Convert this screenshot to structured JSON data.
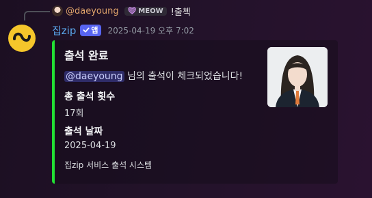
{
  "reply": {
    "username": "@daeyoung",
    "badge_label": "MEOW",
    "badge_icon": "heart-icon",
    "message": "!출첵"
  },
  "message": {
    "bot_name": "집zip",
    "app_tag": "앱",
    "timestamp": "2025-04-19 오후 7:02"
  },
  "embed": {
    "accent_color": "#22e034",
    "title": "출석 완료",
    "mention": "@daeyoung",
    "description_suffix": " 님의 출석이 체크되었습니다!",
    "fields": [
      {
        "name": "총 출석 횟수",
        "value": "17회"
      },
      {
        "name": "출석 날짜",
        "value": "2025-04-19"
      }
    ],
    "footer": "집zip 서비스 출석 시스템",
    "thumbnail_icon": "portrait-photo"
  },
  "colors": {
    "mention_bg": "#5865f2",
    "bot_name": "#5aa8ee",
    "reply_name": "#e0a46b",
    "bot_avatar": "#f5c62b"
  }
}
